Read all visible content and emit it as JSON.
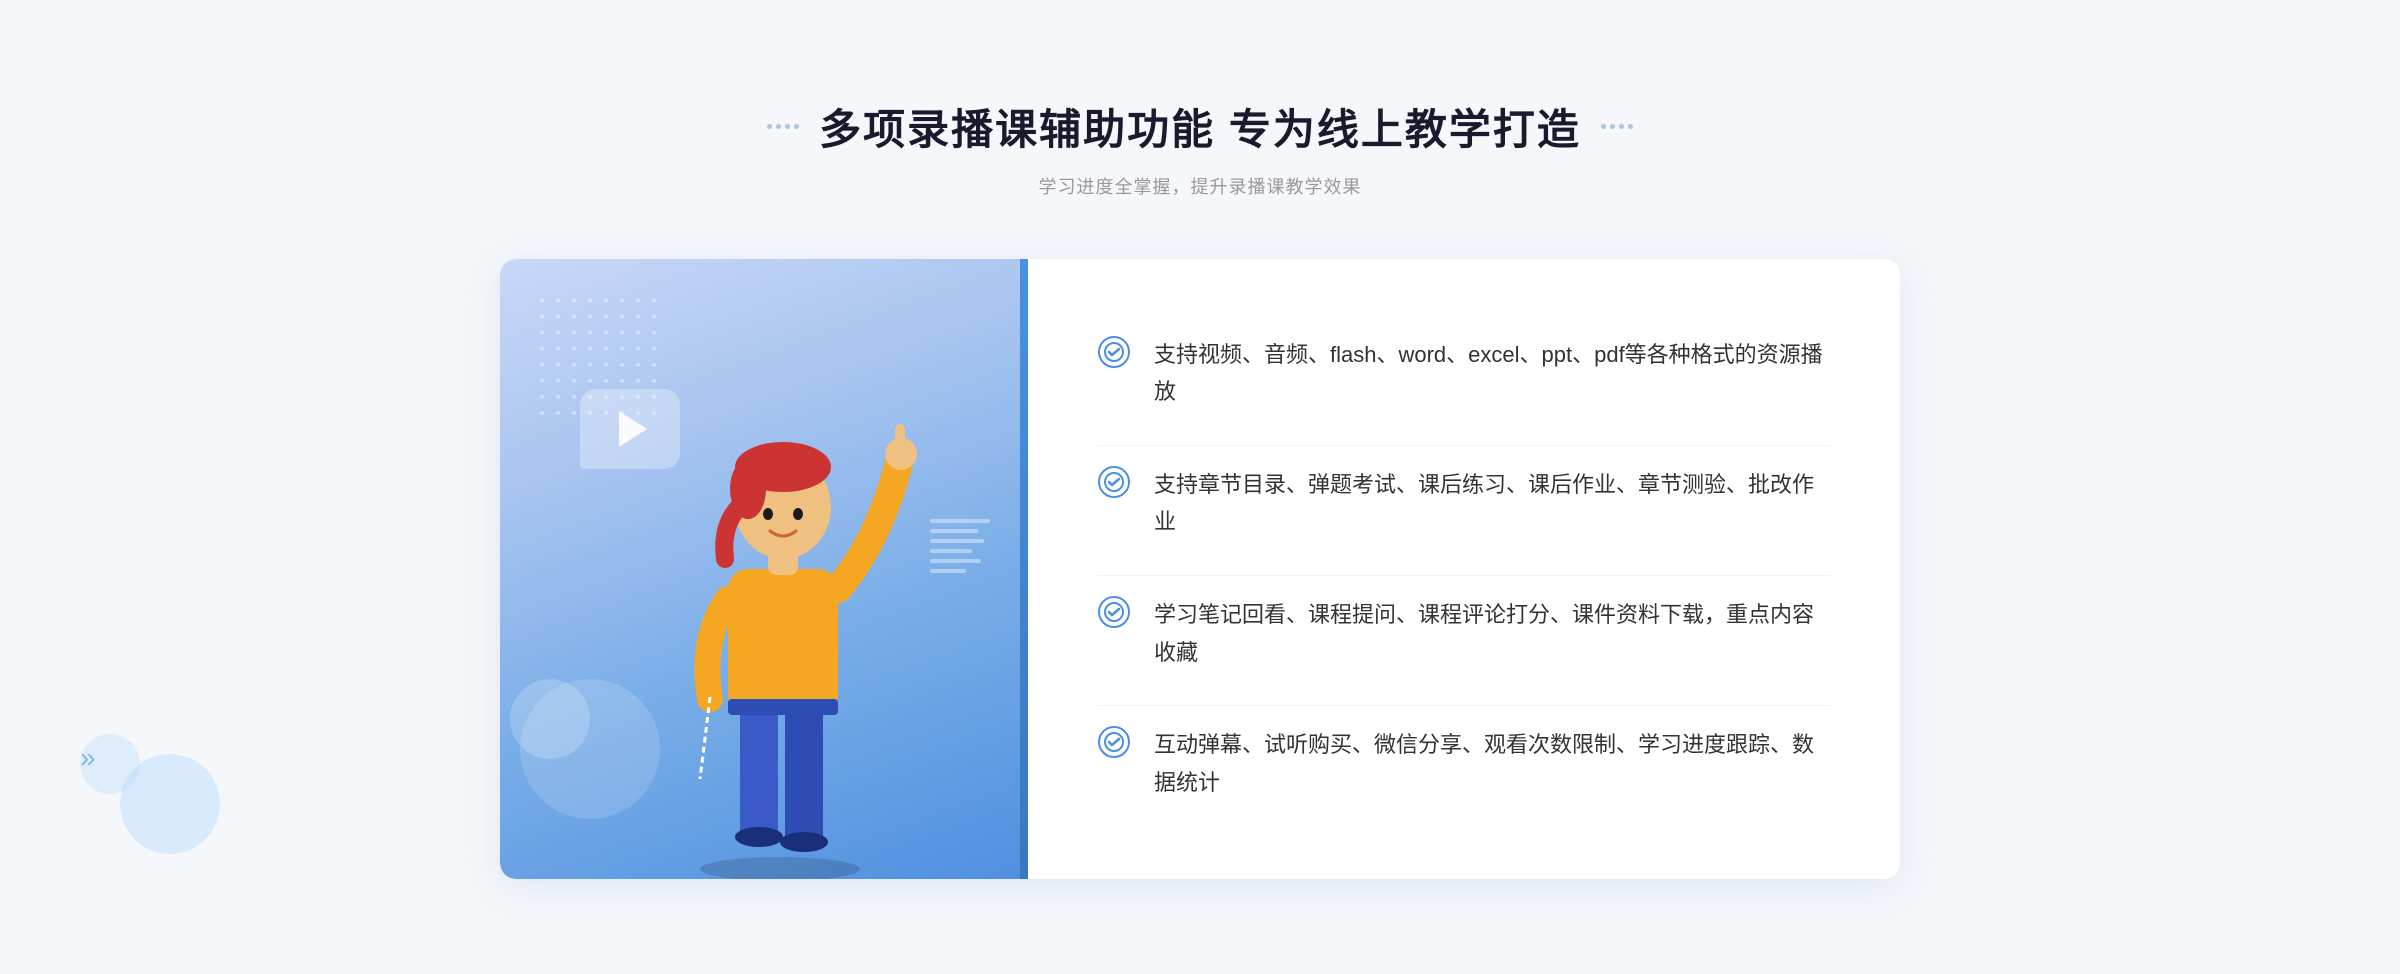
{
  "header": {
    "main_title": "多项录播课辅助功能 专为线上教学打造",
    "sub_title": "学习进度全掌握，提升录播课教学效果"
  },
  "features": [
    {
      "id": "feature-1",
      "text": "支持视频、音频、flash、word、excel、ppt、pdf等各种格式的资源播放"
    },
    {
      "id": "feature-2",
      "text": "支持章节目录、弹题考试、课后练习、课后作业、章节测验、批改作业"
    },
    {
      "id": "feature-3",
      "text": "学习笔记回看、课程提问、课程评论打分、课件资料下载，重点内容收藏"
    },
    {
      "id": "feature-4",
      "text": "互动弹幕、试听购买、微信分享、观看次数限制、学习进度跟踪、数据统计"
    }
  ],
  "icons": {
    "check": "✓",
    "play": "▶",
    "chevron_left": "《"
  },
  "colors": {
    "primary": "#4a90e2",
    "title": "#1a1a2e",
    "subtitle": "#999999",
    "text": "#333333",
    "bg": "#f5f7fa"
  }
}
